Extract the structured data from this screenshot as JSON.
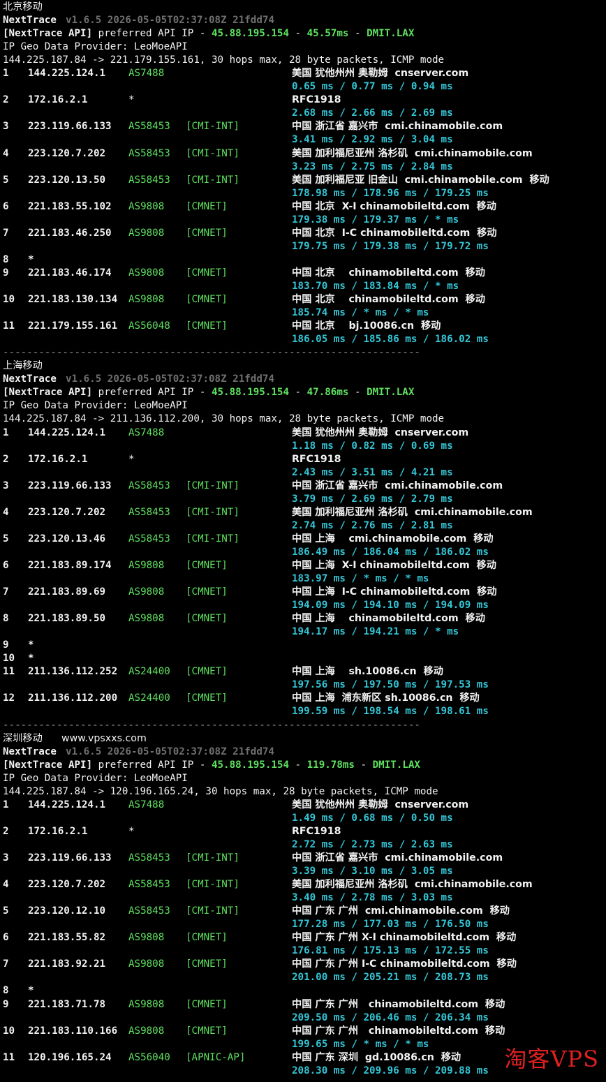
{
  "sections": [
    {
      "title": "北京移动",
      "site": "",
      "header": {
        "app": "NextTrace",
        "version": "v1.6.5 2026-05-05T02:37:08Z 21fdd74",
        "api_label": "[NextTrace API]",
        "api_mid": " preferred API IP - ",
        "api_ip": "45.88.195.154",
        "api_sep1": " - ",
        "api_latency": "45.57ms",
        "api_sep2": " - ",
        "api_node": "DMIT.LAX",
        "geo_provider": "IP Geo Data Provider: LeoMoeAPI",
        "route": "144.225.187.84 -> 221.179.155.161, 30 hops max, 28 byte packets, ICMP mode"
      },
      "hops": [
        {
          "n": "1",
          "ip": "144.225.124.1",
          "as": "AS7488",
          "tag": "",
          "geo": "美国 犹他州州 奥勒姆  cnserver.com",
          "rtt": "0.65 ms / 0.77 ms / 0.94 ms"
        },
        {
          "n": "2",
          "ip": "172.16.2.1",
          "as": "*",
          "tag": "",
          "geo": "RFC1918",
          "rtt": "2.68 ms / 2.66 ms / 2.69 ms"
        },
        {
          "n": "3",
          "ip": "223.119.66.133",
          "as": "AS58453",
          "tag": "[CMI-INT]",
          "geo": "中国 浙江省 嘉兴市  cmi.chinamobile.com",
          "rtt": "3.41 ms / 2.92 ms / 3.04 ms"
        },
        {
          "n": "4",
          "ip": "223.120.7.202",
          "as": "AS58453",
          "tag": "[CMI-INT]",
          "geo": "美国 加利福尼亚州 洛杉矶  cmi.chinamobile.com",
          "rtt": "3.23 ms / 2.75 ms / 2.84 ms"
        },
        {
          "n": "5",
          "ip": "223.120.13.50",
          "as": "AS58453",
          "tag": "[CMI-INT]",
          "geo": "美国 加利福尼亚 旧金山  cmi.chinamobile.com  移动",
          "rtt": "178.98 ms / 178.96 ms / 179.25 ms"
        },
        {
          "n": "6",
          "ip": "221.183.55.102",
          "as": "AS9808",
          "tag": "[CMNET]",
          "geo": "中国 北京  X-I chinamobileltd.com  移动",
          "rtt": "179.38 ms / 179.37 ms / * ms"
        },
        {
          "n": "7",
          "ip": "221.183.46.250",
          "as": "AS9808",
          "tag": "[CMNET]",
          "geo": "中国 北京  I-C chinamobileltd.com  移动",
          "rtt": "179.75 ms / 179.38 ms / 179.72 ms"
        },
        {
          "n": "8",
          "ip": "*",
          "as": "",
          "tag": "",
          "geo": "",
          "rtt": ""
        },
        {
          "n": "9",
          "ip": "221.183.46.174",
          "as": "AS9808",
          "tag": "[CMNET]",
          "geo": "中国 北京    chinamobileltd.com  移动",
          "rtt": "183.70 ms / 183.84 ms / * ms"
        },
        {
          "n": "10",
          "ip": "221.183.130.134",
          "as": "AS9808",
          "tag": "[CMNET]",
          "geo": "中国 北京    chinamobileltd.com  移动",
          "rtt": "185.74 ms / * ms / * ms"
        },
        {
          "n": "11",
          "ip": "221.179.155.161",
          "as": "AS56048",
          "tag": "[CMNET]",
          "geo": "中国 北京    bj.10086.cn  移动",
          "rtt": "186.05 ms / 185.86 ms / 186.02 ms"
        }
      ],
      "separator": "----------------------------------------------------------------------"
    },
    {
      "title": "上海移动",
      "site": "",
      "header": {
        "app": "NextTrace",
        "version": "v1.6.5 2026-05-05T02:37:08Z 21fdd74",
        "api_label": "[NextTrace API]",
        "api_mid": " preferred API IP - ",
        "api_ip": "45.88.195.154",
        "api_sep1": " - ",
        "api_latency": "47.86ms",
        "api_sep2": " - ",
        "api_node": "DMIT.LAX",
        "geo_provider": "IP Geo Data Provider: LeoMoeAPI",
        "route": "144.225.187.84 -> 211.136.112.200, 30 hops max, 28 byte packets, ICMP mode"
      },
      "hops": [
        {
          "n": "1",
          "ip": "144.225.124.1",
          "as": "AS7488",
          "tag": "",
          "geo": "美国 犹他州州 奥勒姆  cnserver.com",
          "rtt": "1.18 ms / 0.82 ms / 0.69 ms"
        },
        {
          "n": "2",
          "ip": "172.16.2.1",
          "as": "*",
          "tag": "",
          "geo": "RFC1918",
          "rtt": "2.43 ms / 3.51 ms / 4.21 ms"
        },
        {
          "n": "3",
          "ip": "223.119.66.133",
          "as": "AS58453",
          "tag": "[CMI-INT]",
          "geo": "中国 浙江省 嘉兴市  cmi.chinamobile.com",
          "rtt": "3.79 ms / 2.69 ms / 2.79 ms"
        },
        {
          "n": "4",
          "ip": "223.120.7.202",
          "as": "AS58453",
          "tag": "[CMI-INT]",
          "geo": "美国 加利福尼亚州 洛杉矶  cmi.chinamobile.com",
          "rtt": "2.74 ms / 2.76 ms / 2.81 ms"
        },
        {
          "n": "5",
          "ip": "223.120.13.46",
          "as": "AS58453",
          "tag": "[CMI-INT]",
          "geo": "中国 上海    cmi.chinamobile.com  移动",
          "rtt": "186.49 ms / 186.04 ms / 186.02 ms"
        },
        {
          "n": "6",
          "ip": "221.183.89.174",
          "as": "AS9808",
          "tag": "[CMNET]",
          "geo": "中国 上海  X-I chinamobileltd.com  移动",
          "rtt": "183.97 ms / * ms / * ms"
        },
        {
          "n": "7",
          "ip": "221.183.89.69",
          "as": "AS9808",
          "tag": "[CMNET]",
          "geo": "中国 上海  I-C chinamobileltd.com  移动",
          "rtt": "194.09 ms / 194.10 ms / 194.09 ms"
        },
        {
          "n": "8",
          "ip": "221.183.89.50",
          "as": "AS9808",
          "tag": "[CMNET]",
          "geo": "中国 上海    chinamobileltd.com  移动",
          "rtt": "194.17 ms / 194.21 ms / * ms"
        },
        {
          "n": "9",
          "ip": "*",
          "as": "",
          "tag": "",
          "geo": "",
          "rtt": ""
        },
        {
          "n": "10",
          "ip": "*",
          "as": "",
          "tag": "",
          "geo": "",
          "rtt": ""
        },
        {
          "n": "11",
          "ip": "211.136.112.252",
          "as": "AS24400",
          "tag": "[CMNET]",
          "geo": "中国 上海    sh.10086.cn  移动",
          "rtt": "197.56 ms / 197.50 ms / 197.53 ms"
        },
        {
          "n": "12",
          "ip": "211.136.112.200",
          "as": "AS24400",
          "tag": "[CMNET]",
          "geo": "中国 上海  浦东新区 sh.10086.cn  移动",
          "rtt": "199.59 ms / 198.54 ms / 198.61 ms"
        }
      ],
      "separator": "----------------------------------------------------------------------"
    },
    {
      "title": "深圳移动",
      "site": "www.vpsxxs.com",
      "header": {
        "app": "NextTrace",
        "version": "v1.6.5 2026-05-05T02:37:08Z 21fdd74",
        "api_label": "[NextTrace API]",
        "api_mid": " preferred API IP - ",
        "api_ip": "45.88.195.154",
        "api_sep1": " - ",
        "api_latency": "119.78ms",
        "api_sep2": " - ",
        "api_node": "DMIT.LAX",
        "geo_provider": "IP Geo Data Provider: LeoMoeAPI",
        "route": "144.225.187.84 -> 120.196.165.24, 30 hops max, 28 byte packets, ICMP mode"
      },
      "hops": [
        {
          "n": "1",
          "ip": "144.225.124.1",
          "as": "AS7488",
          "tag": "",
          "geo": "美国 犹他州州 奥勒姆  cnserver.com",
          "rtt": "1.49 ms / 0.68 ms / 0.50 ms"
        },
        {
          "n": "2",
          "ip": "172.16.2.1",
          "as": "*",
          "tag": "",
          "geo": "RFC1918",
          "rtt": "2.72 ms / 2.73 ms / 2.63 ms"
        },
        {
          "n": "3",
          "ip": "223.119.66.133",
          "as": "AS58453",
          "tag": "[CMI-INT]",
          "geo": "中国 浙江省 嘉兴市  cmi.chinamobile.com",
          "rtt": "3.39 ms / 3.10 ms / 3.05 ms"
        },
        {
          "n": "4",
          "ip": "223.120.7.202",
          "as": "AS58453",
          "tag": "[CMI-INT]",
          "geo": "美国 加利福尼亚州 洛杉矶  cmi.chinamobile.com",
          "rtt": "3.40 ms / 2.78 ms / 3.03 ms"
        },
        {
          "n": "5",
          "ip": "223.120.12.10",
          "as": "AS58453",
          "tag": "[CMI-INT]",
          "geo": "中国 广东 广州  cmi.chinamobile.com  移动",
          "rtt": "177.28 ms / 177.03 ms / 176.50 ms"
        },
        {
          "n": "6",
          "ip": "221.183.55.82",
          "as": "AS9808",
          "tag": "[CMNET]",
          "geo": "中国 广东 广州 X-I chinamobileltd.com  移动",
          "rtt": "176.81 ms / 175.13 ms / 172.55 ms"
        },
        {
          "n": "7",
          "ip": "221.183.92.21",
          "as": "AS9808",
          "tag": "[CMNET]",
          "geo": "中国 广东 广州 I-C chinamobileltd.com  移动",
          "rtt": "201.00 ms / 205.21 ms / 208.73 ms"
        },
        {
          "n": "8",
          "ip": "*",
          "as": "",
          "tag": "",
          "geo": "",
          "rtt": ""
        },
        {
          "n": "9",
          "ip": "221.183.71.78",
          "as": "AS9808",
          "tag": "[CMNET]",
          "geo": "中国 广东 广州   chinamobileltd.com  移动",
          "rtt": "209.50 ms / 206.46 ms / 206.34 ms"
        },
        {
          "n": "10",
          "ip": "221.183.110.166",
          "as": "AS9808",
          "tag": "[CMNET]",
          "geo": "中国 广东 广州   chinamobileltd.com  移动",
          "rtt": "199.65 ms / * ms / * ms"
        },
        {
          "n": "11",
          "ip": "120.196.165.24",
          "as": "AS56040",
          "tag": "[APNIC-AP]",
          "geo": "中国 广东 深圳  gd.10086.cn  移动",
          "rtt": "208.30 ms / 209.96 ms / 209.88 ms"
        }
      ],
      "separator": ""
    }
  ],
  "watermark": "淘客VPS",
  "colors": {
    "background": "#000000",
    "text": "#e8e8e8",
    "dim": "#6f6f6f",
    "green": "#5fe05f",
    "cyan": "#33c6d6",
    "watermark": "#e02020"
  }
}
